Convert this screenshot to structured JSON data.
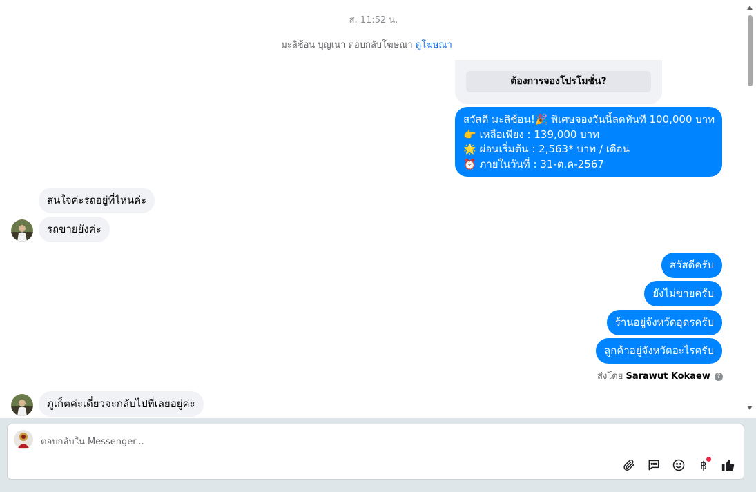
{
  "timestamp": "ส. 11:52 น.",
  "notice": {
    "text": "มะลิซ้อน บุญเนา ตอบกลับโฆษณา",
    "link": "ดูโฆษณา"
  },
  "promo": {
    "button_label": "ต้องการจองโปรโมชั่น?"
  },
  "promo_message": {
    "lines": [
      "สวัสดี มะลิซ้อน!🎉 พิเศษจองวันนี้ลดทันที 100,000 บาท",
      "👉 เหลือเพียง : 139,000 บาท",
      "🌟 ผ่อนเริ่มต้น : 2,563* บาท / เดือน",
      "⏰ ภายในวันที่ : 31-ต.ค-2567"
    ]
  },
  "incoming_1": [
    "สนใจค่ะรถอยู่ที่ไหนค่ะ",
    "รถขายยังค่ะ"
  ],
  "outgoing": [
    "สวัสดีครับ",
    "ยังไม่ขายครับ",
    "ร้านอยู่จังหวัดอุดรครับ",
    "ลูกค้าอยู่จังหวัดอะไรครับ"
  ],
  "sent_by": {
    "prefix": "ส่งโดย",
    "name": "Sarawut Kokaew"
  },
  "incoming_2": [
    "ภูเก็ตค่ะเดี๋ยวจะกลับไปที่เลยอยู่ค่ะ"
  ],
  "composer": {
    "placeholder": "ตอบกลับใน Messenger..."
  },
  "colors": {
    "accent": "#0084ff",
    "incoming_bubble": "#f0f2f5",
    "like": "#1c1e21"
  },
  "icons": [
    "attach-icon",
    "saved-reply-icon",
    "emoji-icon",
    "baht-icon",
    "like-icon"
  ]
}
